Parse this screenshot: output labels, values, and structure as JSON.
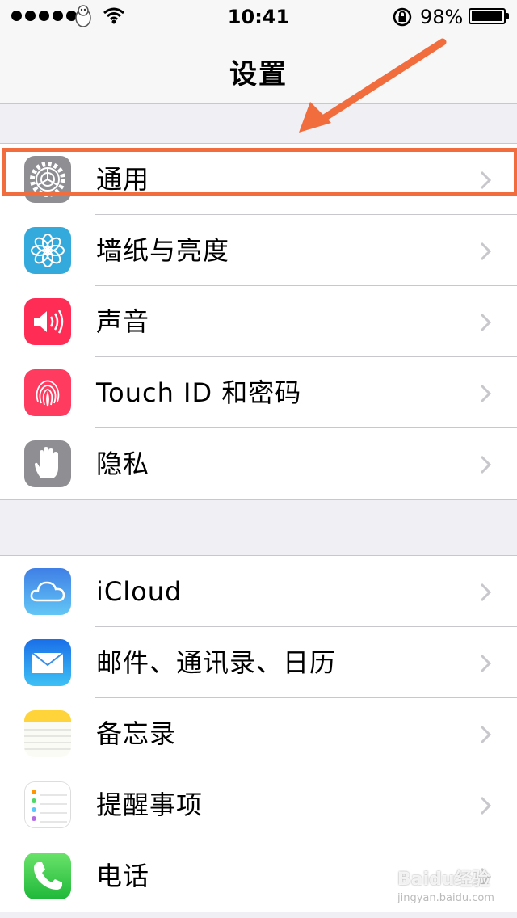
{
  "status": {
    "time": "10:41",
    "battery_pct": "98%",
    "battery_level": 0.98
  },
  "nav": {
    "title": "设置"
  },
  "groups": [
    {
      "items": [
        {
          "label": "通用",
          "icon": "gear-icon"
        },
        {
          "label": "墙纸与亮度",
          "icon": "flower-icon"
        },
        {
          "label": "声音",
          "icon": "speaker-icon"
        },
        {
          "label": "Touch ID 和密码",
          "icon": "fingerprint-icon"
        },
        {
          "label": "隐私",
          "icon": "hand-icon"
        }
      ]
    },
    {
      "items": [
        {
          "label": "iCloud",
          "icon": "cloud-icon"
        },
        {
          "label": "邮件、通讯录、日历",
          "icon": "mail-icon"
        },
        {
          "label": "备忘录",
          "icon": "notes-icon"
        },
        {
          "label": "提醒事项",
          "icon": "reminders-icon"
        },
        {
          "label": "电话",
          "icon": "phone-icon"
        }
      ]
    }
  ],
  "colors": {
    "highlight": "#f26d3d",
    "general": "#8e8e93",
    "wallpaper": "#34aadc",
    "sounds": "#ff2d55",
    "touchid": "#ff3b5f",
    "privacy": "#8e8e93",
    "icloud": "#5ac8fa",
    "mail": "#1e90ff",
    "notes": "#ffd33a",
    "phone": "#4cd964"
  },
  "watermark": {
    "brand": "Baidu经验",
    "url": "jingyan.baidu.com"
  }
}
